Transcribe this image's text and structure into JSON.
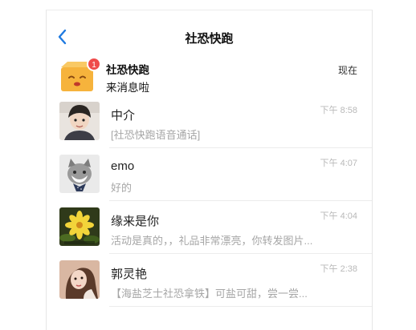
{
  "header": {
    "title": "社恐快跑"
  },
  "notice": {
    "title": "社恐快跑",
    "message": "来消息啦",
    "time": "现在",
    "badge": "1"
  },
  "chats": [
    {
      "name": "中介",
      "preview": "[社恐快跑语音通话]",
      "time": "下午 8:58"
    },
    {
      "name": "emo",
      "preview": "好的",
      "time": "下午 4:07"
    },
    {
      "name": "缘来是你",
      "preview": "活动是真的，，礼品非常漂亮，你转发图片...",
      "time": "下午 4:04"
    },
    {
      "name": "郭灵艳",
      "preview": "【海盐芝士社恐拿铁】可盐可甜，尝一尝...",
      "time": "下午 2:38"
    }
  ],
  "colors": {
    "accent": "#1f7ae0",
    "badge": "#ef4b4b",
    "muted": "#a6a6a6"
  }
}
